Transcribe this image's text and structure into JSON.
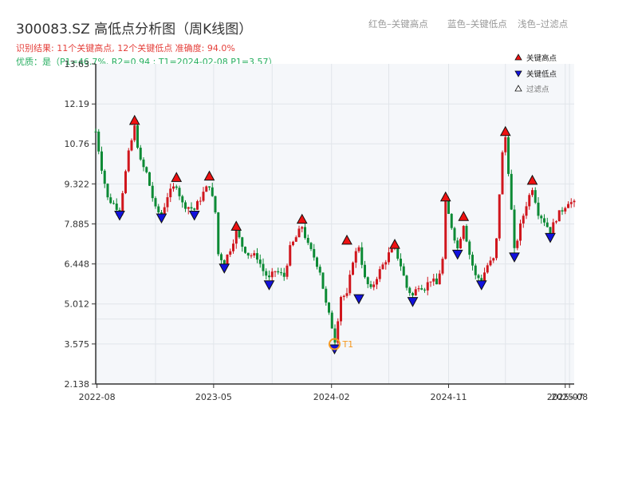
{
  "header": {
    "title": "300083.SZ 高低点分析图（周K线图）",
    "result_text": "识别结果: 11个关键高点, 12个关键低点  准确度: 94.0%",
    "quality_text": "优质：是（P1=46.7%, R2=0.94 ; T1=2024-02-08 P1=3.57）"
  },
  "top_legend": {
    "red_label": "红色–关键高点",
    "blue_label": "蓝色–关键低点",
    "filter_label": "浅色–过滤点"
  },
  "colors": {
    "up": "#d0161d",
    "down": "#0c8a35",
    "high_marker": "#ee1111",
    "low_marker": "#1111dd",
    "t1_marker": "#f59a23",
    "plot_bg": "#f5f7fa",
    "grid": "#e1e5ea",
    "axis": "#333333"
  },
  "chart_data": {
    "type": "candlestick",
    "x_ticks": [
      "2022-08",
      "2023-05",
      "2024-02",
      "2024-11",
      "2025-07",
      "2025-08"
    ],
    "y_ticks": [
      "2.138",
      "3.575",
      "5.012",
      "6.448",
      "7.885",
      "9.322",
      "10.76",
      "12.19",
      "13.63"
    ],
    "ylim": [
      2.138,
      13.63
    ],
    "xlim": [
      "2022-07-29",
      "2025-08-22"
    ],
    "legend": {
      "placement": "top-right",
      "items": [
        {
          "label": "关键高点",
          "marker": "triangle-up",
          "color": "#ee1111"
        },
        {
          "label": "关键低点",
          "marker": "triangle-down",
          "color": "#1111dd"
        },
        {
          "label": "过滤点",
          "marker": "triangle-up-hollow",
          "color": "#888888"
        }
      ]
    },
    "close_path": [
      [
        "2022-07-29",
        11.2
      ],
      [
        "2022-08-12",
        9.9
      ],
      [
        "2022-08-26",
        8.8
      ],
      [
        "2022-09-09",
        8.6
      ],
      [
        "2022-09-23",
        8.4
      ],
      [
        "2022-10-14",
        10.4
      ],
      [
        "2022-10-28",
        11.35
      ],
      [
        "2022-11-11",
        10.1
      ],
      [
        "2022-11-25",
        9.7
      ],
      [
        "2022-12-16",
        8.4
      ],
      [
        "2022-12-30",
        8.2
      ],
      [
        "2023-01-13",
        8.9
      ],
      [
        "2023-02-03",
        9.3
      ],
      [
        "2023-02-17",
        8.6
      ],
      [
        "2023-03-03",
        8.5
      ],
      [
        "2023-03-17",
        8.4
      ],
      [
        "2023-04-07",
        9.0
      ],
      [
        "2023-04-21",
        9.3
      ],
      [
        "2023-05-05",
        8.3
      ],
      [
        "2023-05-12",
        6.8
      ],
      [
        "2023-05-26",
        6.5
      ],
      [
        "2023-06-09",
        7.0
      ],
      [
        "2023-06-23",
        7.6
      ],
      [
        "2023-07-07",
        7.1
      ],
      [
        "2023-07-21",
        6.8
      ],
      [
        "2023-08-11",
        6.7
      ],
      [
        "2023-08-25",
        6.2
      ],
      [
        "2023-09-08",
        5.9
      ],
      [
        "2023-09-22",
        6.2
      ],
      [
        "2023-10-13",
        6.0
      ],
      [
        "2023-10-27",
        7.0
      ],
      [
        "2023-11-10",
        7.4
      ],
      [
        "2023-11-24",
        7.8
      ],
      [
        "2023-12-08",
        7.1
      ],
      [
        "2023-12-22",
        6.7
      ],
      [
        "2024-01-05",
        6.2
      ],
      [
        "2024-01-19",
        5.0
      ],
      [
        "2024-02-02",
        4.2
      ],
      [
        "2024-02-08",
        3.6
      ],
      [
        "2024-02-23",
        5.3
      ],
      [
        "2024-03-08",
        5.3
      ],
      [
        "2024-03-22",
        6.6
      ],
      [
        "2024-04-05",
        7.1
      ],
      [
        "2024-04-19",
        5.9
      ],
      [
        "2024-05-03",
        5.5
      ],
      [
        "2024-05-17",
        6.0
      ],
      [
        "2024-05-31",
        6.4
      ],
      [
        "2024-06-14",
        6.8
      ],
      [
        "2024-06-28",
        7.0
      ],
      [
        "2024-07-12",
        6.4
      ],
      [
        "2024-07-26",
        5.6
      ],
      [
        "2024-08-09",
        5.3
      ],
      [
        "2024-08-23",
        5.7
      ],
      [
        "2024-09-06",
        5.6
      ],
      [
        "2024-09-20",
        5.9
      ],
      [
        "2024-10-04",
        5.7
      ],
      [
        "2024-10-18",
        6.6
      ],
      [
        "2024-10-25",
        8.6
      ],
      [
        "2024-11-08",
        7.8
      ],
      [
        "2024-11-22",
        7.0
      ],
      [
        "2024-12-06",
        7.9
      ],
      [
        "2024-12-20",
        6.8
      ],
      [
        "2025-01-03",
        6.0
      ],
      [
        "2025-01-17",
        5.9
      ],
      [
        "2025-01-31",
        6.4
      ],
      [
        "2025-02-14",
        6.6
      ],
      [
        "2025-02-21",
        7.3
      ],
      [
        "2025-02-28",
        9.0
      ],
      [
        "2025-03-07",
        10.4
      ],
      [
        "2025-03-14",
        11.0
      ],
      [
        "2025-03-21",
        9.8
      ],
      [
        "2025-04-04",
        6.9
      ],
      [
        "2025-04-18",
        7.8
      ],
      [
        "2025-05-02",
        8.6
      ],
      [
        "2025-05-16",
        9.2
      ],
      [
        "2025-05-30",
        8.3
      ],
      [
        "2025-06-13",
        8.0
      ],
      [
        "2025-06-27",
        7.6
      ],
      [
        "2025-07-11",
        8.1
      ],
      [
        "2025-07-25",
        8.4
      ],
      [
        "2025-08-08",
        8.7
      ],
      [
        "2025-08-22",
        8.6
      ]
    ],
    "high_points": [
      {
        "date": "2022-10-28",
        "value": 11.4
      },
      {
        "date": "2023-02-03",
        "value": 9.35
      },
      {
        "date": "2023-04-21",
        "value": 9.4
      },
      {
        "date": "2023-06-23",
        "value": 7.6
      },
      {
        "date": "2023-11-24",
        "value": 7.85
      },
      {
        "date": "2024-03-08",
        "value": 7.1
      },
      {
        "date": "2024-06-28",
        "value": 6.95
      },
      {
        "date": "2024-10-25",
        "value": 8.65
      },
      {
        "date": "2024-12-06",
        "value": 7.95
      },
      {
        "date": "2025-03-14",
        "value": 11.0
      },
      {
        "date": "2025-05-16",
        "value": 9.25
      }
    ],
    "low_points": [
      {
        "date": "2022-09-23",
        "value": 8.4
      },
      {
        "date": "2022-12-30",
        "value": 8.3
      },
      {
        "date": "2023-03-17",
        "value": 8.4
      },
      {
        "date": "2023-05-26",
        "value": 6.5
      },
      {
        "date": "2023-09-08",
        "value": 5.9
      },
      {
        "date": "2024-02-08",
        "value": 3.6
      },
      {
        "date": "2024-04-05",
        "value": 5.4
      },
      {
        "date": "2024-08-09",
        "value": 5.3
      },
      {
        "date": "2024-11-22",
        "value": 7.0
      },
      {
        "date": "2025-01-17",
        "value": 5.9
      },
      {
        "date": "2025-04-04",
        "value": 6.9
      },
      {
        "date": "2025-06-27",
        "value": 7.6
      }
    ],
    "t1": {
      "label": "T1",
      "date": "2024-02-08",
      "value": 3.57
    }
  }
}
